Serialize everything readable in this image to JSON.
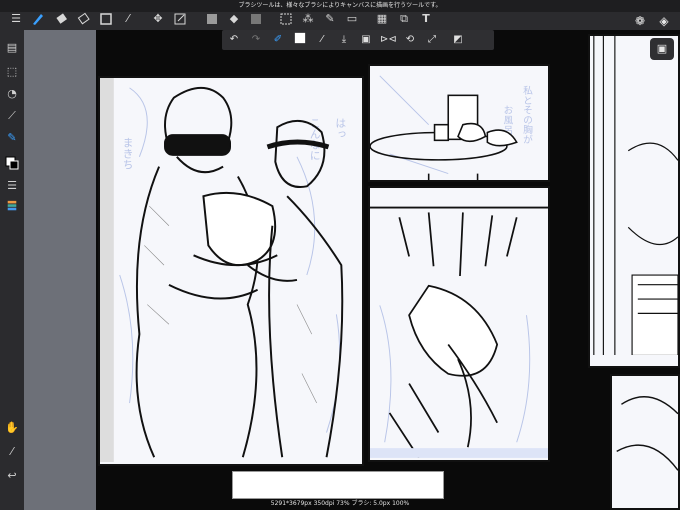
{
  "hint_text": "ブラシツールは、様々なブラシによりキャンバスに描画を行うツールです。",
  "status_text": "5291*3679px 350dpi 73% ブラシ: 5.0px 100%",
  "colors": {
    "toolbar": "#2b2b2e",
    "accent": "#3aa0ff",
    "canvas_bg": "#0a0a0a",
    "page_gray": "#6d7078",
    "panel_bg": "#f6f7fb"
  },
  "top_tools": [
    "menu-icon",
    "brush-icon",
    "eraser-icon",
    "blur-eraser-icon",
    "rectangle-icon",
    "smudge-icon",
    "move-icon",
    "transform-icon",
    "fill-color-icon",
    "bucket-icon",
    "gradient-icon",
    "select-icon",
    "magic-wand-icon",
    "select-pen-icon",
    "select-eraser-icon",
    "panel-select-icon",
    "text-icon"
  ],
  "sub_tools": [
    "undo-icon",
    "redo-icon",
    "brush-size-icon",
    "color-swatch-icon",
    "eyedropper-icon",
    "download-icon",
    "canvas-icon",
    "flip-icon",
    "rotate-icon",
    "fit-icon",
    "edit-icon"
  ],
  "left_tools": [
    "copy-icon",
    "selection-icon",
    "timer-icon",
    "ruler-icon",
    "pen-icon",
    "color-icon",
    "layers-list-icon",
    "palette-icon",
    "hand-icon",
    "pipette-icon",
    "back-icon"
  ],
  "right_tools": [
    "materials-icon",
    "layers-icon",
    "fullscreen-icon"
  ],
  "manga_text": {
    "bubble_1": "まきち",
    "bubble_2": "こんなに",
    "bubble_3": "はっ",
    "bubble_4": "私とその胸が",
    "bubble_5": "お風呂"
  }
}
